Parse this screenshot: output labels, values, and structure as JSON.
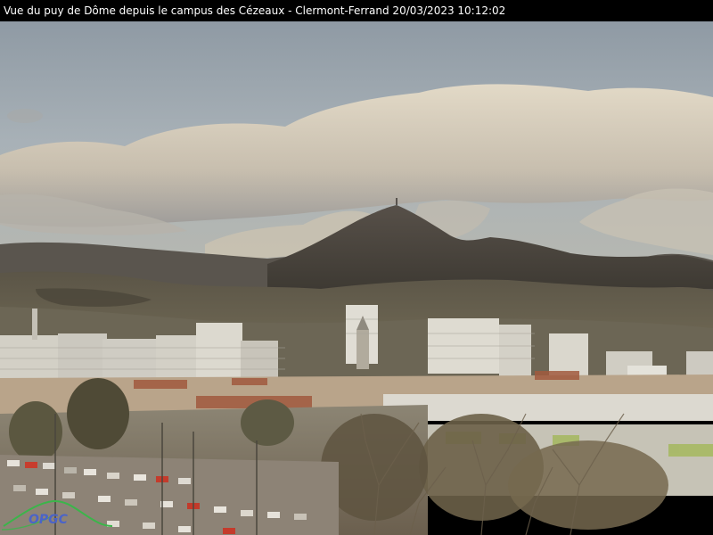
{
  "caption": "Vue du puy de Dôme depuis le campus des Cézeaux - Clermont-Ferrand 20/03/2023 10:12:02",
  "logo": {
    "text": "OPGC",
    "color": "#4a63c9",
    "swoosh_color": "#3bb54a"
  },
  "scene": {
    "subject": "puy-de-dome-volcano",
    "sky_color": "#9ea9b1",
    "cloud_color": "#d8cdb8",
    "mountain_color": "#4d4641",
    "city_color": "#c9c6bd"
  }
}
